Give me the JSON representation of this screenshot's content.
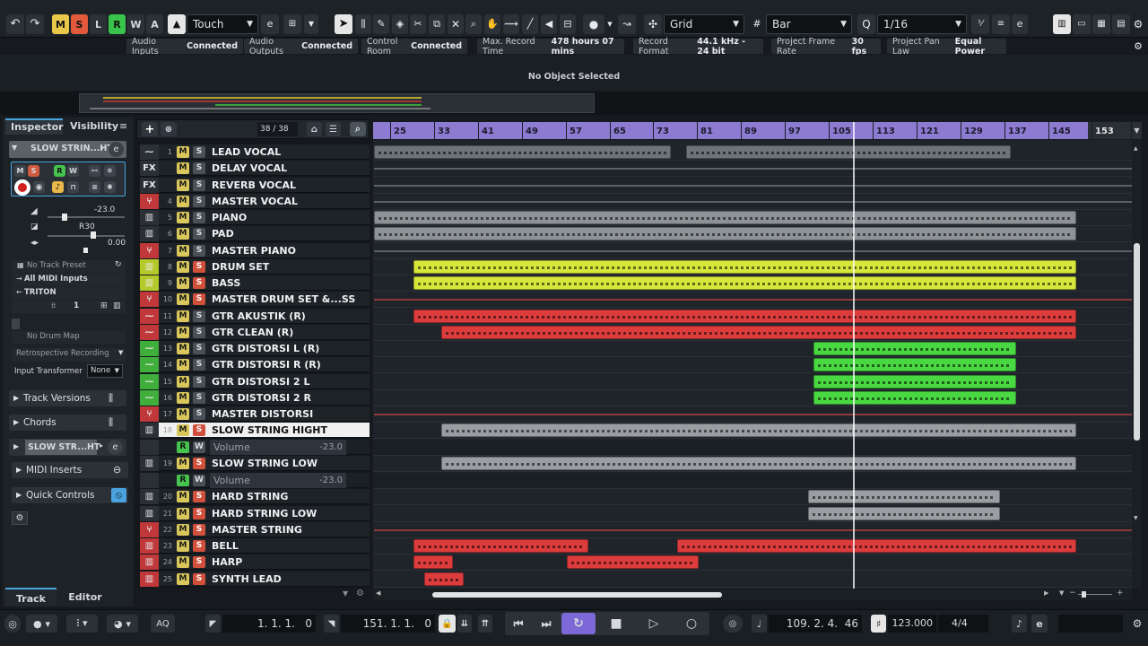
{
  "toolbar": {
    "undo_icon": "undo-icon",
    "redo_icon": "redo-icon",
    "state_buttons": [
      {
        "label": "M",
        "color": "#e8c74a"
      },
      {
        "label": "S",
        "color": "#e3593c"
      },
      {
        "label": "L",
        "color": "#2b3137"
      },
      {
        "label": "R",
        "color": "#39c34a"
      },
      {
        "label": "W",
        "color": "#2b3137"
      },
      {
        "label": "A",
        "color": "#2b3137"
      }
    ],
    "automation_mode": "Touch",
    "grid_type": "Grid",
    "grid_unit": "Bar",
    "quantize": "1/16"
  },
  "status": {
    "items": [
      {
        "label": "Audio Inputs",
        "value": "Connected"
      },
      {
        "label": "Audio Outputs",
        "value": "Connected"
      },
      {
        "label": "Control Room",
        "value": "Connected"
      },
      {
        "label": "Max. Record Time",
        "value": "478 hours 07 mins"
      },
      {
        "label": "Record Format",
        "value": "44.1 kHz - 24 bit"
      },
      {
        "label": "Project Frame Rate",
        "value": "30 fps"
      },
      {
        "label": "Project Pan Law",
        "value": "Equal Power"
      }
    ],
    "info_line": "No Object Selected"
  },
  "inspector": {
    "tab_inspector": "Inspector",
    "tab_visibility": "Visibility",
    "track_name": "SLOW STRIN...HT",
    "volume": "-23.0",
    "pan": "R30",
    "delay": "0.00",
    "track_preset": "No Track Preset",
    "midi_input": "All MIDI Inputs",
    "midi_output": "TRITON",
    "channel": "1",
    "drum_map": "No Drum Map",
    "retro_rec": "Retrospective Recording",
    "input_transformer_label": "Input Transformer",
    "input_transformer_value": "None",
    "sections": [
      "Track Versions",
      "Chords"
    ],
    "sub_track": "SLOW STR...HT",
    "midi_inserts": "MIDI Inserts",
    "quick_controls": "Quick Controls",
    "bottom_tab_track": "Track",
    "bottom_tab_editor": "Editor"
  },
  "tracklist": {
    "count": "38 / 38",
    "tracks": [
      {
        "num": "1",
        "name": "LEAD VOCAL",
        "icon": "audio-wave-icon",
        "iconc": "#2a3036",
        "s_on": false
      },
      {
        "num": "",
        "name": "DELAY VOCAL",
        "icon": "fx-channel-icon",
        "iconc": "#2a3036",
        "s_on": false
      },
      {
        "num": "",
        "name": "REVERB VOCAL",
        "icon": "fx-channel-icon",
        "iconc": "#2a3036",
        "s_on": false
      },
      {
        "num": "4",
        "name": "MASTER VOCAL",
        "icon": "group-channel-icon",
        "iconc": "#c0383a",
        "s_on": false
      },
      {
        "num": "5",
        "name": "PIANO",
        "icon": "instrument-icon",
        "iconc": "#2a3036",
        "s_on": false
      },
      {
        "num": "6",
        "name": "PAD",
        "icon": "instrument-icon",
        "iconc": "#2a3036",
        "s_on": false
      },
      {
        "num": "7",
        "name": "MASTER PIANO",
        "icon": "group-channel-icon",
        "iconc": "#c0383a",
        "s_on": false
      },
      {
        "num": "8",
        "name": "DRUM SET",
        "icon": "instrument-icon",
        "iconc": "#b6c92a",
        "s_on": true
      },
      {
        "num": "9",
        "name": "BASS",
        "icon": "instrument-icon",
        "iconc": "#b6c92a",
        "s_on": true
      },
      {
        "num": "10",
        "name": "MASTER DRUM SET &...SS",
        "icon": "group-channel-icon",
        "iconc": "#c0383a",
        "s_on": true
      },
      {
        "num": "11",
        "name": "GTR AKUSTIK (R)",
        "icon": "audio-wave-icon",
        "iconc": "#c0383a",
        "s_on": false
      },
      {
        "num": "12",
        "name": "GTR CLEAN (R)",
        "icon": "audio-wave-icon",
        "iconc": "#c0383a",
        "s_on": false
      },
      {
        "num": "13",
        "name": "GTR DISTORSI L (R)",
        "icon": "audio-wave-icon",
        "iconc": "#3fae3a",
        "s_on": false
      },
      {
        "num": "14",
        "name": "GTR DISTORSI R (R)",
        "icon": "audio-wave-icon",
        "iconc": "#3fae3a",
        "s_on": false
      },
      {
        "num": "15",
        "name": "GTR DISTORSI 2 L",
        "icon": "audio-wave-icon",
        "iconc": "#3fae3a",
        "s_on": false
      },
      {
        "num": "16",
        "name": "GTR DISTORSI 2 R",
        "icon": "audio-wave-icon",
        "iconc": "#3fae3a",
        "s_on": false
      },
      {
        "num": "17",
        "name": "MASTER DISTORSI",
        "icon": "group-channel-icon",
        "iconc": "#c0383a",
        "s_on": false
      },
      {
        "num": "18",
        "name": "SLOW STRING HIGHT",
        "icon": "instrument-icon",
        "iconc": "#2a3036",
        "s_on": true
      },
      {
        "num": "19",
        "name": "SLOW STRING LOW",
        "icon": "instrument-icon",
        "iconc": "#2a3036",
        "s_on": true
      },
      {
        "num": "20",
        "name": "HARD STRING",
        "icon": "instrument-icon",
        "iconc": "#2a3036",
        "s_on": true
      },
      {
        "num": "21",
        "name": "HARD STRING LOW",
        "icon": "instrument-icon",
        "iconc": "#2a3036",
        "s_on": true
      },
      {
        "num": "22",
        "name": "MASTER STRING",
        "icon": "group-channel-icon",
        "iconc": "#c0383a",
        "s_on": true
      },
      {
        "num": "23",
        "name": "BELL",
        "icon": "instrument-icon",
        "iconc": "#c0383a",
        "s_on": true
      },
      {
        "num": "24",
        "name": "HARP",
        "icon": "instrument-icon",
        "iconc": "#c0383a",
        "s_on": true
      },
      {
        "num": "25",
        "name": "SYNTH LEAD",
        "icon": "instrument-icon",
        "iconc": "#c0383a",
        "s_on": true
      }
    ],
    "auto_label": "Volume",
    "auto_value": "-23.0"
  },
  "ruler": {
    "marks": [
      "25",
      "33",
      "41",
      "49",
      "57",
      "65",
      "73",
      "81",
      "89",
      "97",
      "105",
      "113",
      "121",
      "129",
      "137",
      "145",
      "153"
    ]
  },
  "transport": {
    "left_locator": "1. 1. 1.   0",
    "right_locator": "151. 1. 1.   0",
    "position": "109. 2. 4.  46",
    "tempo": "123.000",
    "signature": "4/4",
    "aq_label": "AQ"
  }
}
